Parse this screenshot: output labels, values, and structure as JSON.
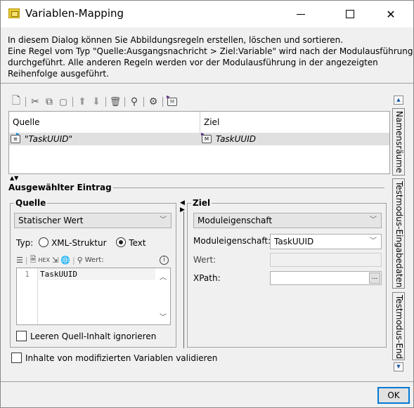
{
  "window": {
    "title": "Variablen-Mapping",
    "icon": "dialog-icon",
    "controls": {
      "minimize": "minimize",
      "maximize": "maximize",
      "close": "close"
    }
  },
  "description": {
    "lines": [
      "In diesem Dialog können Sie Abbildungsregeln erstellen, löschen und sortieren.",
      "Eine Regel vom Typ \"Quelle:Ausgangsnachricht > Ziel:Variable\" wird nach der Modulausführung",
      "durchgeführt. Alle anderen Regeln werden vor der Modulausführung in der angezeigten",
      "Reihenfolge ausgeführt."
    ]
  },
  "toolbar": {
    "items": [
      {
        "icon": "new-rule-icon",
        "glyph": "🗋"
      },
      {
        "icon": "cut-icon",
        "glyph": "✂"
      },
      {
        "icon": "copy-icon",
        "glyph": "⧉"
      },
      {
        "icon": "paste-icon",
        "glyph": "📋"
      },
      {
        "icon": "move-up-icon",
        "glyph": "⬆"
      },
      {
        "icon": "move-down-icon",
        "glyph": "⬇"
      },
      {
        "icon": "delete-icon",
        "glyph": "🗑"
      },
      {
        "icon": "search-icon",
        "glyph": "🔍"
      },
      {
        "icon": "settings-icon",
        "glyph": "⚙"
      },
      {
        "icon": "module-icon",
        "glyph": "M"
      }
    ]
  },
  "table": {
    "columns": [
      "Quelle",
      "Ziel"
    ],
    "rows": [
      {
        "source": "\"TaskUUID\"",
        "target": "TaskUUID"
      }
    ]
  },
  "selected_entry": {
    "title": "Ausgewählter Eintrag",
    "source": {
      "title": "Quelle",
      "type_select": "Statischer Wert",
      "type_label": "Typ:",
      "radio_xml": "XML-Struktur",
      "radio_text": "Text",
      "selected_radio": "Text",
      "value_label": "Wert:",
      "editor_line_numbers": [
        "1"
      ],
      "editor_lines": [
        "TaskUUID"
      ],
      "ignore_empty_label": "Leeren Quell-Inhalt ignorieren",
      "ignore_empty_checked": false
    },
    "target": {
      "title": "Ziel",
      "type_select": "Moduleigenschaft",
      "module_property_label": "Moduleigenschaft:",
      "module_property_value": "TaskUUID",
      "value_label": "Wert:",
      "value": "",
      "xpath_label": "XPath:",
      "xpath_value": "",
      "xpath_button": "..."
    }
  },
  "validate_label": "Inhalte von modifizierten Variablen validieren",
  "validate_checked": false,
  "side_tabs": [
    "Namensräume",
    "Testmodus-Eingabedaten",
    "Testmodus-Endd"
  ],
  "ok_label": "OK",
  "colors": {
    "accent": "#0078d7",
    "selected_row": "#e0e0e0"
  }
}
